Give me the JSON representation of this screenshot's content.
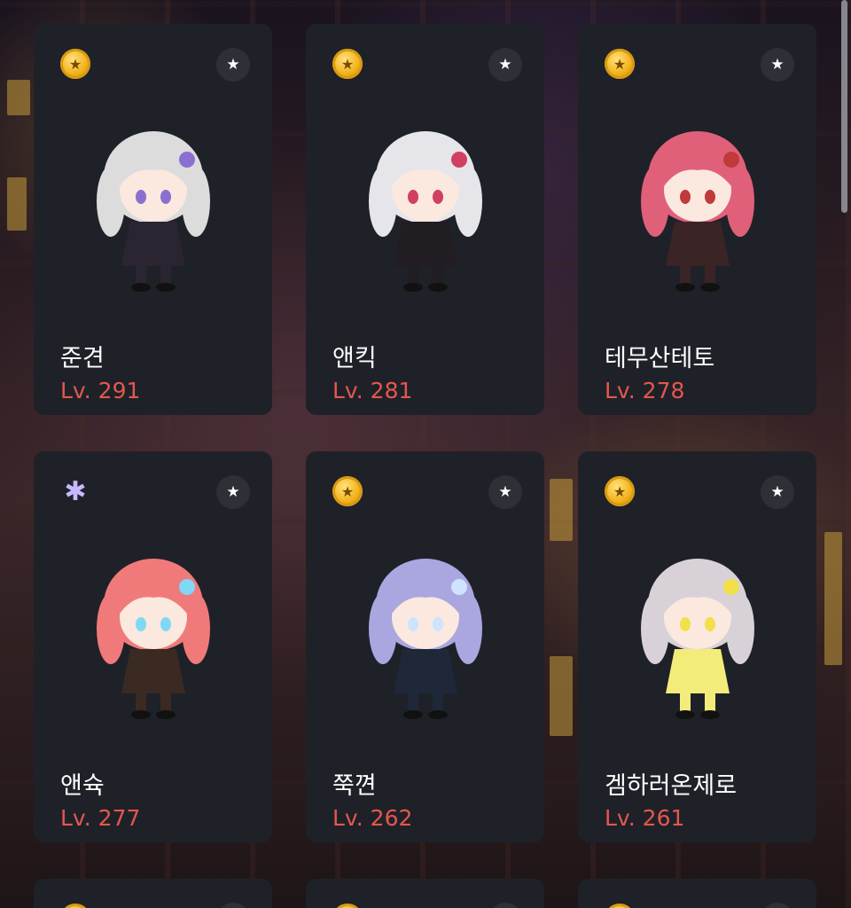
{
  "characters": [
    {
      "name": "준견",
      "level": "Lv. 291",
      "world_icon": "gold-coin-icon",
      "hair": "#dcdcdc",
      "outfit": "#2a2530",
      "accent": "#8b6fd0"
    },
    {
      "name": "앤킥",
      "level": "Lv. 281",
      "world_icon": "gold-coin-icon",
      "hair": "#e6e6ea",
      "outfit": "#221d22",
      "accent": "#d04060"
    },
    {
      "name": "테무산테토",
      "level": "Lv. 278",
      "world_icon": "gold-coin-icon",
      "hair": "#e0607a",
      "outfit": "#3a2426",
      "accent": "#c03a3a"
    },
    {
      "name": "앤슉",
      "level": "Lv. 277",
      "world_icon": "crystal-icon",
      "hair": "#f07a7a",
      "outfit": "#3a2a22",
      "accent": "#7fd8f5"
    },
    {
      "name": "쭉껸",
      "level": "Lv. 262",
      "world_icon": "gold-coin-icon",
      "hair": "#a9a6e0",
      "outfit": "#1e2838",
      "accent": "#cfe2ff"
    },
    {
      "name": "겜하러온제로",
      "level": "Lv. 261",
      "world_icon": "gold-coin-icon",
      "hair": "#d8d2d8",
      "outfit": "#f4ec7a",
      "accent": "#f2e04a"
    }
  ],
  "partial_cards": 3,
  "icons": {
    "favorite": "star-icon",
    "gold_symbol": "★",
    "crystal_symbol": "✱",
    "star_symbol": "★"
  },
  "colors": {
    "card_bg": "#1f2128",
    "name": "#ffffff",
    "level": "#e4574d",
    "star_button_bg": "#2e3038"
  }
}
